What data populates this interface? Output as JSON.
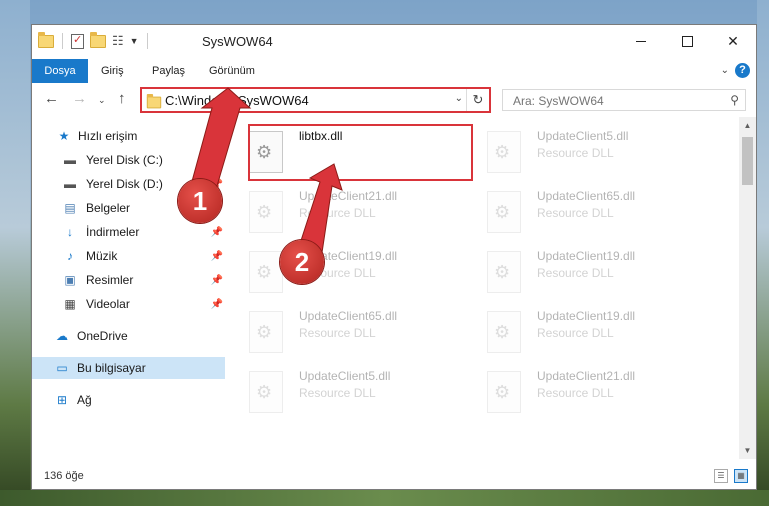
{
  "window": {
    "title": "SysWOW64"
  },
  "ribbon": {
    "tabs": [
      "Dosya",
      "Giriş",
      "Paylaş",
      "Görünüm"
    ],
    "help_label": "?"
  },
  "nav": {
    "address": "C:\\Windows\\SysWOW64",
    "search_placeholder": "Ara: SysWOW64"
  },
  "sidebar": {
    "items": [
      {
        "label": "Hızlı erişim",
        "icon": "star-icon"
      },
      {
        "label": "Yerel Disk (C:)",
        "icon": "drive-icon"
      },
      {
        "label": "Yerel Disk (D:)",
        "icon": "drive-icon"
      },
      {
        "label": "Belgeler",
        "icon": "documents-icon"
      },
      {
        "label": "İndirmeler",
        "icon": "download-icon"
      },
      {
        "label": "Müzik",
        "icon": "music-icon"
      },
      {
        "label": "Resimler",
        "icon": "pictures-icon"
      },
      {
        "label": "Videolar",
        "icon": "videos-icon"
      },
      {
        "label": "OneDrive",
        "icon": "cloud-icon"
      },
      {
        "label": "Bu bilgisayar",
        "icon": "computer-icon"
      },
      {
        "label": "Ağ",
        "icon": "network-icon"
      }
    ]
  },
  "files": [
    {
      "name": "libtbx.dll",
      "type": ""
    },
    {
      "name": "UpdateClient5.dll",
      "type": "Resource DLL"
    },
    {
      "name": "UpdateClient21.dll",
      "type": "Resource DLL"
    },
    {
      "name": "UpdateClient65.dll",
      "type": "Resource DLL"
    },
    {
      "name": "UpdateClient19.dll",
      "type": "Resource DLL"
    },
    {
      "name": "UpdateClient19.dll",
      "type": "Resource DLL"
    },
    {
      "name": "UpdateClient65.dll",
      "type": "Resource DLL"
    },
    {
      "name": "UpdateClient19.dll",
      "type": "Resource DLL"
    },
    {
      "name": "UpdateClient5.dll",
      "type": "Resource DLL"
    },
    {
      "name": "UpdateClient21.dll",
      "type": "Resource DLL"
    }
  ],
  "status": {
    "item_count": "136 öğe"
  },
  "annotations": {
    "step1": "1",
    "step2": "2",
    "color": "#d9343a"
  }
}
